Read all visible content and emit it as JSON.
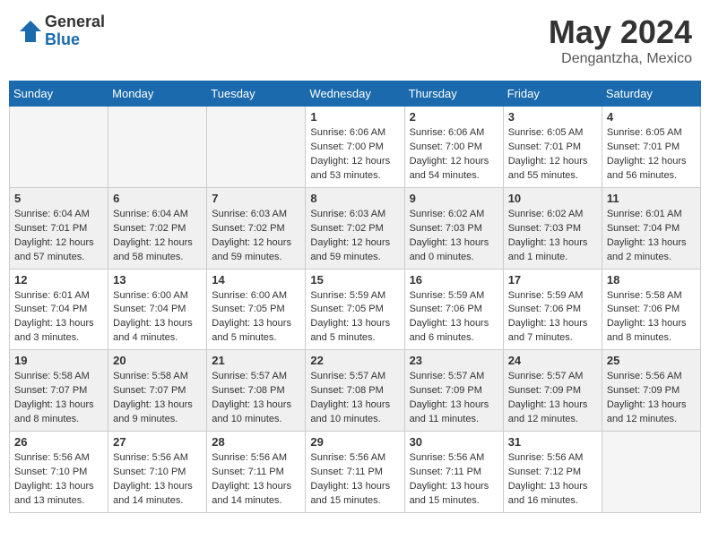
{
  "header": {
    "logo": {
      "general": "General",
      "blue": "Blue"
    },
    "title": "May 2024",
    "location": "Dengantzha, Mexico"
  },
  "weekdays": [
    "Sunday",
    "Monday",
    "Tuesday",
    "Wednesday",
    "Thursday",
    "Friday",
    "Saturday"
  ],
  "weeks": [
    [
      {
        "day": "",
        "info": ""
      },
      {
        "day": "",
        "info": ""
      },
      {
        "day": "",
        "info": ""
      },
      {
        "day": "1",
        "info": "Sunrise: 6:06 AM\nSunset: 7:00 PM\nDaylight: 12 hours\nand 53 minutes."
      },
      {
        "day": "2",
        "info": "Sunrise: 6:06 AM\nSunset: 7:00 PM\nDaylight: 12 hours\nand 54 minutes."
      },
      {
        "day": "3",
        "info": "Sunrise: 6:05 AM\nSunset: 7:01 PM\nDaylight: 12 hours\nand 55 minutes."
      },
      {
        "day": "4",
        "info": "Sunrise: 6:05 AM\nSunset: 7:01 PM\nDaylight: 12 hours\nand 56 minutes."
      }
    ],
    [
      {
        "day": "5",
        "info": "Sunrise: 6:04 AM\nSunset: 7:01 PM\nDaylight: 12 hours\nand 57 minutes."
      },
      {
        "day": "6",
        "info": "Sunrise: 6:04 AM\nSunset: 7:02 PM\nDaylight: 12 hours\nand 58 minutes."
      },
      {
        "day": "7",
        "info": "Sunrise: 6:03 AM\nSunset: 7:02 PM\nDaylight: 12 hours\nand 59 minutes."
      },
      {
        "day": "8",
        "info": "Sunrise: 6:03 AM\nSunset: 7:02 PM\nDaylight: 12 hours\nand 59 minutes."
      },
      {
        "day": "9",
        "info": "Sunrise: 6:02 AM\nSunset: 7:03 PM\nDaylight: 13 hours\nand 0 minutes."
      },
      {
        "day": "10",
        "info": "Sunrise: 6:02 AM\nSunset: 7:03 PM\nDaylight: 13 hours\nand 1 minute."
      },
      {
        "day": "11",
        "info": "Sunrise: 6:01 AM\nSunset: 7:04 PM\nDaylight: 13 hours\nand 2 minutes."
      }
    ],
    [
      {
        "day": "12",
        "info": "Sunrise: 6:01 AM\nSunset: 7:04 PM\nDaylight: 13 hours\nand 3 minutes."
      },
      {
        "day": "13",
        "info": "Sunrise: 6:00 AM\nSunset: 7:04 PM\nDaylight: 13 hours\nand 4 minutes."
      },
      {
        "day": "14",
        "info": "Sunrise: 6:00 AM\nSunset: 7:05 PM\nDaylight: 13 hours\nand 5 minutes."
      },
      {
        "day": "15",
        "info": "Sunrise: 5:59 AM\nSunset: 7:05 PM\nDaylight: 13 hours\nand 5 minutes."
      },
      {
        "day": "16",
        "info": "Sunrise: 5:59 AM\nSunset: 7:06 PM\nDaylight: 13 hours\nand 6 minutes."
      },
      {
        "day": "17",
        "info": "Sunrise: 5:59 AM\nSunset: 7:06 PM\nDaylight: 13 hours\nand 7 minutes."
      },
      {
        "day": "18",
        "info": "Sunrise: 5:58 AM\nSunset: 7:06 PM\nDaylight: 13 hours\nand 8 minutes."
      }
    ],
    [
      {
        "day": "19",
        "info": "Sunrise: 5:58 AM\nSunset: 7:07 PM\nDaylight: 13 hours\nand 8 minutes."
      },
      {
        "day": "20",
        "info": "Sunrise: 5:58 AM\nSunset: 7:07 PM\nDaylight: 13 hours\nand 9 minutes."
      },
      {
        "day": "21",
        "info": "Sunrise: 5:57 AM\nSunset: 7:08 PM\nDaylight: 13 hours\nand 10 minutes."
      },
      {
        "day": "22",
        "info": "Sunrise: 5:57 AM\nSunset: 7:08 PM\nDaylight: 13 hours\nand 10 minutes."
      },
      {
        "day": "23",
        "info": "Sunrise: 5:57 AM\nSunset: 7:09 PM\nDaylight: 13 hours\nand 11 minutes."
      },
      {
        "day": "24",
        "info": "Sunrise: 5:57 AM\nSunset: 7:09 PM\nDaylight: 13 hours\nand 12 minutes."
      },
      {
        "day": "25",
        "info": "Sunrise: 5:56 AM\nSunset: 7:09 PM\nDaylight: 13 hours\nand 12 minutes."
      }
    ],
    [
      {
        "day": "26",
        "info": "Sunrise: 5:56 AM\nSunset: 7:10 PM\nDaylight: 13 hours\nand 13 minutes."
      },
      {
        "day": "27",
        "info": "Sunrise: 5:56 AM\nSunset: 7:10 PM\nDaylight: 13 hours\nand 14 minutes."
      },
      {
        "day": "28",
        "info": "Sunrise: 5:56 AM\nSunset: 7:11 PM\nDaylight: 13 hours\nand 14 minutes."
      },
      {
        "day": "29",
        "info": "Sunrise: 5:56 AM\nSunset: 7:11 PM\nDaylight: 13 hours\nand 15 minutes."
      },
      {
        "day": "30",
        "info": "Sunrise: 5:56 AM\nSunset: 7:11 PM\nDaylight: 13 hours\nand 15 minutes."
      },
      {
        "day": "31",
        "info": "Sunrise: 5:56 AM\nSunset: 7:12 PM\nDaylight: 13 hours\nand 16 minutes."
      },
      {
        "day": "",
        "info": ""
      }
    ]
  ]
}
